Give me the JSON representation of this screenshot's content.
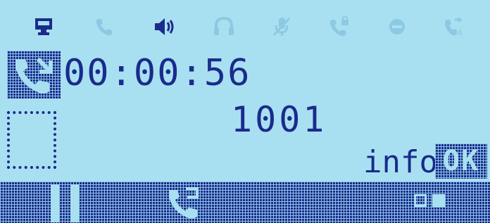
{
  "status_icons": [
    {
      "name": "network-icon",
      "active": true
    },
    {
      "name": "phone-handset-icon",
      "active": false
    },
    {
      "name": "speaker-icon",
      "active": true
    },
    {
      "name": "headset-icon",
      "active": false
    },
    {
      "name": "microphone-mute-icon",
      "active": false
    },
    {
      "name": "phone-lock-icon",
      "active": false
    },
    {
      "name": "do-not-disturb-icon",
      "active": false
    },
    {
      "name": "call-forward-icon",
      "active": false
    }
  ],
  "call": {
    "timer": "00:00:56",
    "number": "1001"
  },
  "softkeys": {
    "info_label": "info",
    "ok_label": "OK"
  },
  "colors": {
    "background": "#a9e0f1",
    "foreground": "#1a2b8c",
    "inactive": "#8cc9e3"
  }
}
